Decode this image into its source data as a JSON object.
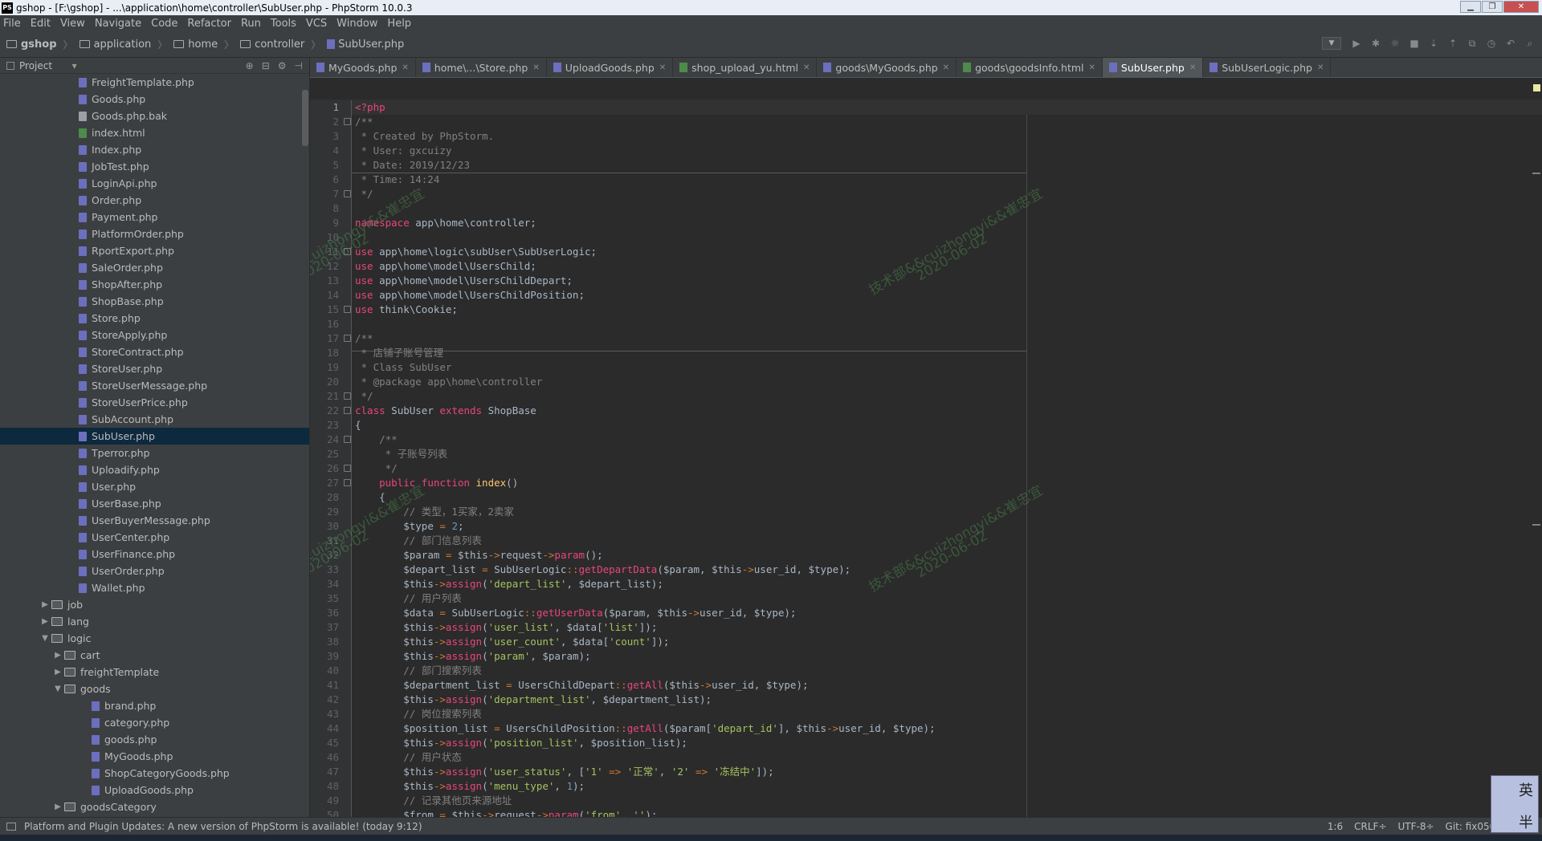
{
  "window": {
    "title": "gshop - [F:\\gshop] - ...\\application\\home\\controller\\SubUser.php - PhpStorm 10.0.3",
    "app_icon": "PS"
  },
  "menu": [
    "File",
    "Edit",
    "View",
    "Navigate",
    "Code",
    "Refactor",
    "Run",
    "Tools",
    "VCS",
    "Window",
    "Help"
  ],
  "breadcrumbs": [
    "gshop",
    "application",
    "home",
    "controller",
    "SubUser.php"
  ],
  "project_panel": {
    "title": "Project",
    "tree": [
      {
        "label": "FreightTemplate.php",
        "type": "php",
        "indent": 6
      },
      {
        "label": "Goods.php",
        "type": "php",
        "indent": 6
      },
      {
        "label": "Goods.php.bak",
        "type": "bak",
        "indent": 6
      },
      {
        "label": "index.html",
        "type": "html",
        "indent": 6
      },
      {
        "label": "Index.php",
        "type": "php",
        "indent": 6
      },
      {
        "label": "JobTest.php",
        "type": "php",
        "indent": 6
      },
      {
        "label": "LoginApi.php",
        "type": "php",
        "indent": 6
      },
      {
        "label": "Order.php",
        "type": "php",
        "indent": 6
      },
      {
        "label": "Payment.php",
        "type": "php",
        "indent": 6
      },
      {
        "label": "PlatformOrder.php",
        "type": "php",
        "indent": 6
      },
      {
        "label": "RportExport.php",
        "type": "php",
        "indent": 6
      },
      {
        "label": "SaleOrder.php",
        "type": "php",
        "indent": 6
      },
      {
        "label": "ShopAfter.php",
        "type": "php",
        "indent": 6
      },
      {
        "label": "ShopBase.php",
        "type": "php",
        "indent": 6
      },
      {
        "label": "Store.php",
        "type": "php",
        "indent": 6
      },
      {
        "label": "StoreApply.php",
        "type": "php",
        "indent": 6
      },
      {
        "label": "StoreContract.php",
        "type": "php",
        "indent": 6
      },
      {
        "label": "StoreUser.php",
        "type": "php",
        "indent": 6
      },
      {
        "label": "StoreUserMessage.php",
        "type": "php",
        "indent": 6
      },
      {
        "label": "StoreUserPrice.php",
        "type": "php",
        "indent": 6
      },
      {
        "label": "SubAccount.php",
        "type": "php",
        "indent": 6
      },
      {
        "label": "SubUser.php",
        "type": "php",
        "indent": 6,
        "selected": true
      },
      {
        "label": "Tperror.php",
        "type": "php",
        "indent": 6
      },
      {
        "label": "Uploadify.php",
        "type": "php",
        "indent": 6
      },
      {
        "label": "User.php",
        "type": "php",
        "indent": 6
      },
      {
        "label": "UserBase.php",
        "type": "php",
        "indent": 6
      },
      {
        "label": "UserBuyerMessage.php",
        "type": "php",
        "indent": 6
      },
      {
        "label": "UserCenter.php",
        "type": "php",
        "indent": 6
      },
      {
        "label": "UserFinance.php",
        "type": "php",
        "indent": 6
      },
      {
        "label": "UserOrder.php",
        "type": "php",
        "indent": 6
      },
      {
        "label": "Wallet.php",
        "type": "php",
        "indent": 6
      },
      {
        "label": "job",
        "type": "folder",
        "indent": 3,
        "arrow": "▶"
      },
      {
        "label": "lang",
        "type": "folder",
        "indent": 3,
        "arrow": "▶"
      },
      {
        "label": "logic",
        "type": "folder",
        "indent": 3,
        "arrow": "▼"
      },
      {
        "label": "cart",
        "type": "folder",
        "indent": 4,
        "arrow": "▶"
      },
      {
        "label": "freightTemplate",
        "type": "folder",
        "indent": 4,
        "arrow": "▶"
      },
      {
        "label": "goods",
        "type": "folder",
        "indent": 4,
        "arrow": "▼"
      },
      {
        "label": "brand.php",
        "type": "php",
        "indent": 7
      },
      {
        "label": "category.php",
        "type": "php",
        "indent": 7
      },
      {
        "label": "goods.php",
        "type": "php",
        "indent": 7
      },
      {
        "label": "MyGoods.php",
        "type": "php",
        "indent": 7
      },
      {
        "label": "ShopCategoryGoods.php",
        "type": "php",
        "indent": 7
      },
      {
        "label": "UploadGoods.php",
        "type": "php",
        "indent": 7
      },
      {
        "label": "goodsCategory",
        "type": "folder",
        "indent": 4,
        "arrow": "▶"
      }
    ]
  },
  "tabs": [
    {
      "label": "MyGoods.php",
      "type": "php"
    },
    {
      "label": "home\\...\\Store.php",
      "type": "php"
    },
    {
      "label": "UploadGoods.php",
      "type": "php"
    },
    {
      "label": "shop_upload_yu.html",
      "type": "html"
    },
    {
      "label": "goods\\MyGoods.php",
      "type": "php"
    },
    {
      "label": "goods\\goodsInfo.html",
      "type": "html"
    },
    {
      "label": "SubUser.php",
      "type": "php",
      "active": true
    },
    {
      "label": "SubUserLogic.php",
      "type": "php"
    }
  ],
  "code_lines": [
    "<span class=\"kw2\">&lt;?php</span>",
    "<span class=\"cm\">/**</span>",
    "<span class=\"cm\"> * Created by PhpStorm.</span>",
    "<span class=\"cm\"> * User: gxcuizy</span>",
    "<span class=\"cm\"> * Date: 2019/12/23</span>",
    "<span class=\"cm\"> * Time: 14:24</span>",
    "<span class=\"cm\"> */</span>",
    "",
    "<span class=\"kw2\">namespace</span> <span class=\"plain\">app\\home\\controller;</span>",
    "",
    "<span class=\"kw2\">use</span> <span class=\"plain\">app\\home\\logic\\subUser\\SubUserLogic;</span>",
    "<span class=\"kw2\">use</span> <span class=\"plain\">app\\home\\model\\UsersChild;</span>",
    "<span class=\"kw2\">use</span> <span class=\"plain\">app\\home\\model\\UsersChildDepart;</span>",
    "<span class=\"kw2\">use</span> <span class=\"plain\">app\\home\\model\\UsersChildPosition;</span>",
    "<span class=\"kw2\">use</span> <span class=\"plain\">think\\Cookie;</span>",
    "",
    "<span class=\"cm\">/**</span>",
    "<span class=\"cm\"> * 店铺子账号管理</span>",
    "<span class=\"cm\"> * Class SubUser</span>",
    "<span class=\"cm\"> * @package app\\home\\controller</span>",
    "<span class=\"cm\"> */</span>",
    "<span class=\"kw2\">class</span> <span class=\"plain\">SubUser</span> <span class=\"kw2\">extends</span> <span class=\"plain\">ShopBase</span>",
    "<span class=\"plain\">{</span>",
    "    <span class=\"cm\">/**</span>",
    "    <span class=\"cm\"> * 子账号列表</span>",
    "    <span class=\"cm\"> */</span>",
    "    <span class=\"kw2\">public function</span> <span class=\"fn\">index</span><span class=\"plain\">()</span>",
    "    <span class=\"plain\">{</span>",
    "        <span class=\"cm\">// 类型，1买家，2卖家</span>",
    "        <span class=\"plain\">$type</span> <span class=\"arrow\">=</span> <span class=\"num\">2</span><span class=\"plain\">;</span>",
    "        <span class=\"cm\">// 部门信息列表</span>",
    "        <span class=\"plain\">$param</span> <span class=\"arrow\">=</span> <span class=\"plain\">$this</span><span class=\"arrow\">-&gt;</span><span class=\"plain\">request</span><span class=\"arrow\">-&gt;</span><span class=\"kw2\">param</span><span class=\"plain\">();</span>",
    "        <span class=\"plain\">$depart_list</span> <span class=\"arrow\">=</span> <span class=\"plain\">SubUserLogic</span><span class=\"arrow\">::</span><span class=\"kw2\">getDepartData</span><span class=\"plain\">($param, $this</span><span class=\"arrow\">-&gt;</span><span class=\"plain\">user_id, $type);</span>",
    "        <span class=\"plain\">$this</span><span class=\"arrow\">-&gt;</span><span class=\"kw2\">assign</span><span class=\"plain\">(</span><span class=\"str2\">'depart_list'</span><span class=\"plain\">, $depart_list);</span>",
    "        <span class=\"cm\">// 用户列表</span>",
    "        <span class=\"plain\">$data</span> <span class=\"arrow\">=</span> <span class=\"plain\">SubUserLogic</span><span class=\"arrow\">::</span><span class=\"kw2\">getUserData</span><span class=\"plain\">($param, $this</span><span class=\"arrow\">-&gt;</span><span class=\"plain\">user_id, $type);</span>",
    "        <span class=\"plain\">$this</span><span class=\"arrow\">-&gt;</span><span class=\"kw2\">assign</span><span class=\"plain\">(</span><span class=\"str2\">'user_list'</span><span class=\"plain\">, $data[</span><span class=\"str2\">'list'</span><span class=\"plain\">]);</span>",
    "        <span class=\"plain\">$this</span><span class=\"arrow\">-&gt;</span><span class=\"kw2\">assign</span><span class=\"plain\">(</span><span class=\"str2\">'user_count'</span><span class=\"plain\">, $data[</span><span class=\"str2\">'count'</span><span class=\"plain\">]);</span>",
    "        <span class=\"plain\">$this</span><span class=\"arrow\">-&gt;</span><span class=\"kw2\">assign</span><span class=\"plain\">(</span><span class=\"str2\">'param'</span><span class=\"plain\">, $param);</span>",
    "        <span class=\"cm\">// 部门搜索列表</span>",
    "        <span class=\"plain\">$department_list</span> <span class=\"arrow\">=</span> <span class=\"plain\">UsersChildDepart</span><span class=\"arrow\">::</span><span class=\"kw2\">getAll</span><span class=\"plain\">($this</span><span class=\"arrow\">-&gt;</span><span class=\"plain\">user_id, $type);</span>",
    "        <span class=\"plain\">$this</span><span class=\"arrow\">-&gt;</span><span class=\"kw2\">assign</span><span class=\"plain\">(</span><span class=\"str2\">'department_list'</span><span class=\"plain\">, $department_list);</span>",
    "        <span class=\"cm\">// 岗位搜索列表</span>",
    "        <span class=\"plain\">$position_list</span> <span class=\"arrow\">=</span> <span class=\"plain\">UsersChildPosition</span><span class=\"arrow\">::</span><span class=\"kw2\">getAll</span><span class=\"plain\">($param[</span><span class=\"str2\">'depart_id'</span><span class=\"plain\">], $this</span><span class=\"arrow\">-&gt;</span><span class=\"plain\">user_id, $type);</span>",
    "        <span class=\"plain\">$this</span><span class=\"arrow\">-&gt;</span><span class=\"kw2\">assign</span><span class=\"plain\">(</span><span class=\"str2\">'position_list'</span><span class=\"plain\">, $position_list);</span>",
    "        <span class=\"cm\">// 用户状态</span>",
    "        <span class=\"plain\">$this</span><span class=\"arrow\">-&gt;</span><span class=\"kw2\">assign</span><span class=\"plain\">(</span><span class=\"str2\">'user_status'</span><span class=\"plain\">, [</span><span class=\"str2\">'1'</span> <span class=\"arrow\">=&gt;</span> <span class=\"str2\">'正常'</span><span class=\"plain\">, </span><span class=\"str2\">'2'</span> <span class=\"arrow\">=&gt;</span> <span class=\"str2\">'冻结中'</span><span class=\"plain\">]);</span>",
    "        <span class=\"plain\">$this</span><span class=\"arrow\">-&gt;</span><span class=\"kw2\">assign</span><span class=\"plain\">(</span><span class=\"str2\">'menu_type'</span><span class=\"plain\">, </span><span class=\"num\">1</span><span class=\"plain\">);</span>",
    "        <span class=\"cm\">// 记录其他页来源地址</span>",
    "        <span class=\"plain\">$from</span> <span class=\"arrow\">=</span> <span class=\"plain\">$this</span><span class=\"arrow\">-&gt;</span><span class=\"plain\">request</span><span class=\"arrow\">-&gt;</span><span class=\"kw2\">param</span><span class=\"plain\">(</span><span class=\"str2\">'from'</span><span class=\"plain\">, </span><span class=\"str2\">''</span><span class=\"plain\">);</span>"
  ],
  "fold_lines": [
    2,
    7,
    11,
    15,
    17,
    21,
    22,
    24,
    26,
    27
  ],
  "watermarks": [
    {
      "text": "技术部&&cuizhongyi&&崔忠宜"
    },
    {
      "text": "2020-06-02"
    }
  ],
  "status": {
    "message": "Platform and Plugin Updates: A new version of PhpStorm is available! (today 9:12)",
    "position": "1:6",
    "line_sep": "CRLF÷",
    "encoding": "UTF-8÷",
    "vcs": "Git: fix0508÷"
  },
  "ime": {
    "t1": "英",
    "t2": "半"
  }
}
